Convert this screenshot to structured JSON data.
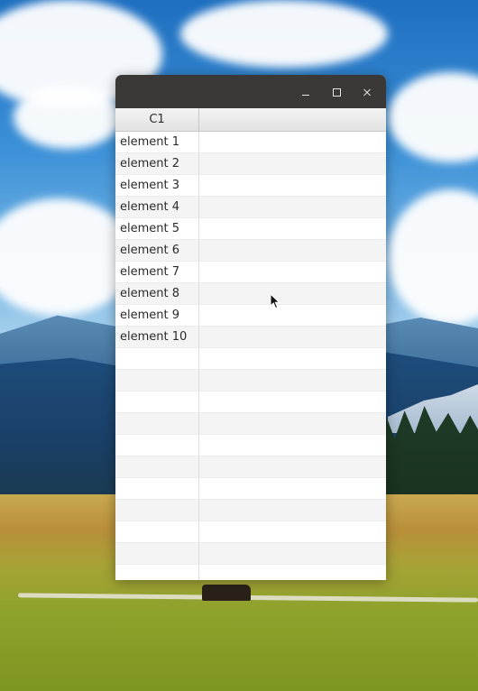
{
  "window": {
    "title": "",
    "controls": {
      "minimize_icon": "minimize-icon",
      "maximize_icon": "maximize-icon",
      "close_icon": "close-icon"
    }
  },
  "table": {
    "columns": [
      "C1"
    ],
    "rows": [
      "element 1",
      "element 2",
      "element 3",
      "element 4",
      "element 5",
      "element 6",
      "element 7",
      "element 8",
      "element 9",
      "element 10",
      "",
      "",
      "",
      "",
      "",
      "",
      "",
      "",
      "",
      "",
      ""
    ]
  },
  "colors": {
    "titlebar": "#3a3937",
    "row_even": "#f4f4f4",
    "row_odd": "#ffffff",
    "header_bg": "#e8e8e8"
  }
}
